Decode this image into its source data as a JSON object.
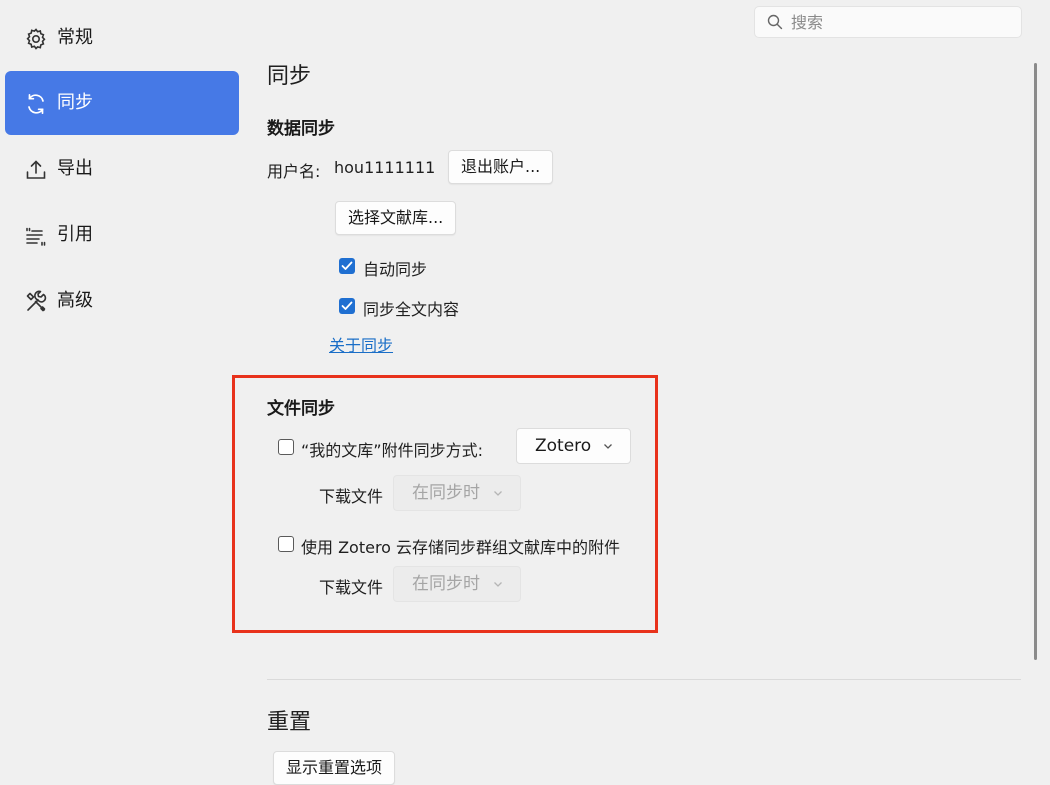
{
  "sidebar": {
    "items": [
      {
        "label": "常规",
        "icon": "gear-icon"
      },
      {
        "label": "同步",
        "icon": "sync-icon",
        "active": true
      },
      {
        "label": "导出",
        "icon": "export-icon"
      },
      {
        "label": "引用",
        "icon": "cite-icon"
      },
      {
        "label": "高级",
        "icon": "tools-icon"
      }
    ]
  },
  "search": {
    "placeholder": "搜索"
  },
  "page_title": "同步",
  "data_sync": {
    "heading": "数据同步",
    "username_label": "用户名:",
    "username": "hou1111111",
    "logout_button": "退出账户...",
    "choose_library_button": "选择文献库...",
    "auto_sync_label": "自动同步",
    "auto_sync_checked": true,
    "fulltext_sync_label": "同步全文内容",
    "fulltext_sync_checked": true,
    "about_link": "关于同步"
  },
  "file_sync": {
    "heading": "文件同步",
    "my_library_label": "“我的文库”附件同步方式:",
    "my_library_checked": false,
    "method_select": "Zotero",
    "download_label_1": "下载文件",
    "download_select_1": "在同步时",
    "group_label": "使用 Zotero 云存储同步群组文献库中的附件",
    "group_checked": false,
    "download_label_2": "下载文件",
    "download_select_2": "在同步时"
  },
  "reset": {
    "heading": "重置",
    "show_options_button": "显示重置选项"
  },
  "colors": {
    "accent": "#4679e6",
    "checkbox": "#1f6fd1",
    "link": "#1a6ec7",
    "highlight": "#e8321b"
  }
}
